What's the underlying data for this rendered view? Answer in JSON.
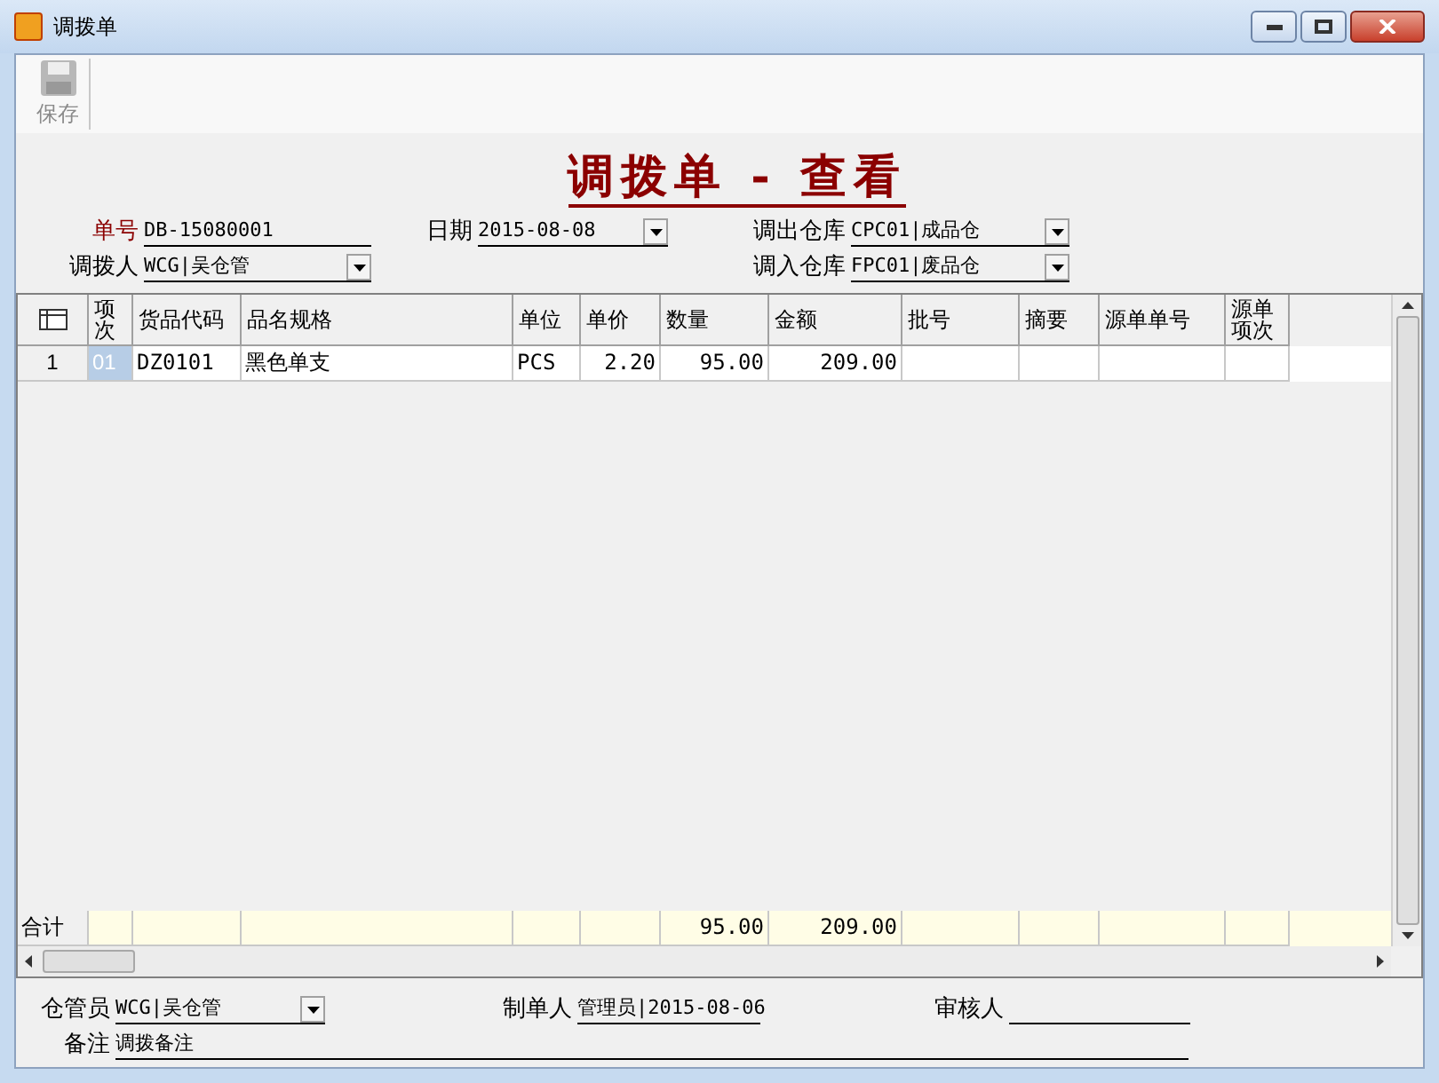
{
  "window": {
    "title": "调拨单"
  },
  "toolbar": {
    "buttons": [
      {
        "label": "保存",
        "disabled": true
      }
    ]
  },
  "form_title": "调拨单 - 查看",
  "header": {
    "columns": [
      [
        {
          "label": "单号",
          "value": "DB-15080001",
          "kind": "text",
          "required": true
        },
        {
          "label": "调拨人",
          "value": "WCG|吴仓管",
          "kind": "dropdown",
          "required": false
        }
      ],
      [
        {
          "label": "日期",
          "value": "2015-08-08",
          "kind": "dropdown",
          "required": false
        }
      ],
      [
        {
          "label": "调出仓库",
          "value": "CPC01|成品仓",
          "kind": "dropdown",
          "required": false
        },
        {
          "label": "调入仓库",
          "value": "FPC01|废品仓",
          "kind": "dropdown",
          "required": false
        }
      ]
    ]
  },
  "table": {
    "columns": [
      {
        "label": "项次",
        "kind": "text"
      },
      {
        "label": "货品代码",
        "kind": "text"
      },
      {
        "label": "品名规格",
        "kind": "text"
      },
      {
        "label": "单位",
        "kind": "text"
      },
      {
        "label": "单价",
        "kind": "number"
      },
      {
        "label": "数量",
        "kind": "number"
      },
      {
        "label": "金额",
        "kind": "number"
      },
      {
        "label": "批号",
        "kind": "text"
      },
      {
        "label": "摘要",
        "kind": "text"
      },
      {
        "label": "源单单号",
        "kind": "text"
      },
      {
        "label": "源单项次",
        "kind": "text"
      }
    ],
    "rows": [
      {
        "index": "1",
        "cells": [
          {
            "text": "01",
            "selected": true
          },
          {
            "text": "DZ0101",
            "selected": false
          },
          {
            "text": "黑色单支",
            "selected": false
          },
          {
            "text": "PCS",
            "selected": false
          },
          {
            "text": "2.20",
            "selected": false
          },
          {
            "text": "95.00",
            "selected": false
          },
          {
            "text": "209.00",
            "selected": false
          },
          {
            "text": "",
            "selected": false
          },
          {
            "text": "",
            "selected": false
          },
          {
            "text": "",
            "selected": false
          },
          {
            "text": "",
            "selected": false
          }
        ]
      }
    ],
    "total": {
      "label": "合计",
      "cells": [
        "",
        "",
        "",
        "",
        "",
        "95.00",
        "209.00",
        "",
        "",
        "",
        ""
      ]
    }
  },
  "footer": {
    "fields": [
      {
        "label": "仓管员",
        "value": "WCG|吴仓管",
        "kind": "dropdown"
      },
      {
        "label": "制单人",
        "value": "管理员|2015-08-06",
        "kind": "text"
      },
      {
        "label": "审核人",
        "kind": "text"
      }
    ],
    "note": {
      "label": "备注",
      "value": "调拨备注"
    }
  }
}
